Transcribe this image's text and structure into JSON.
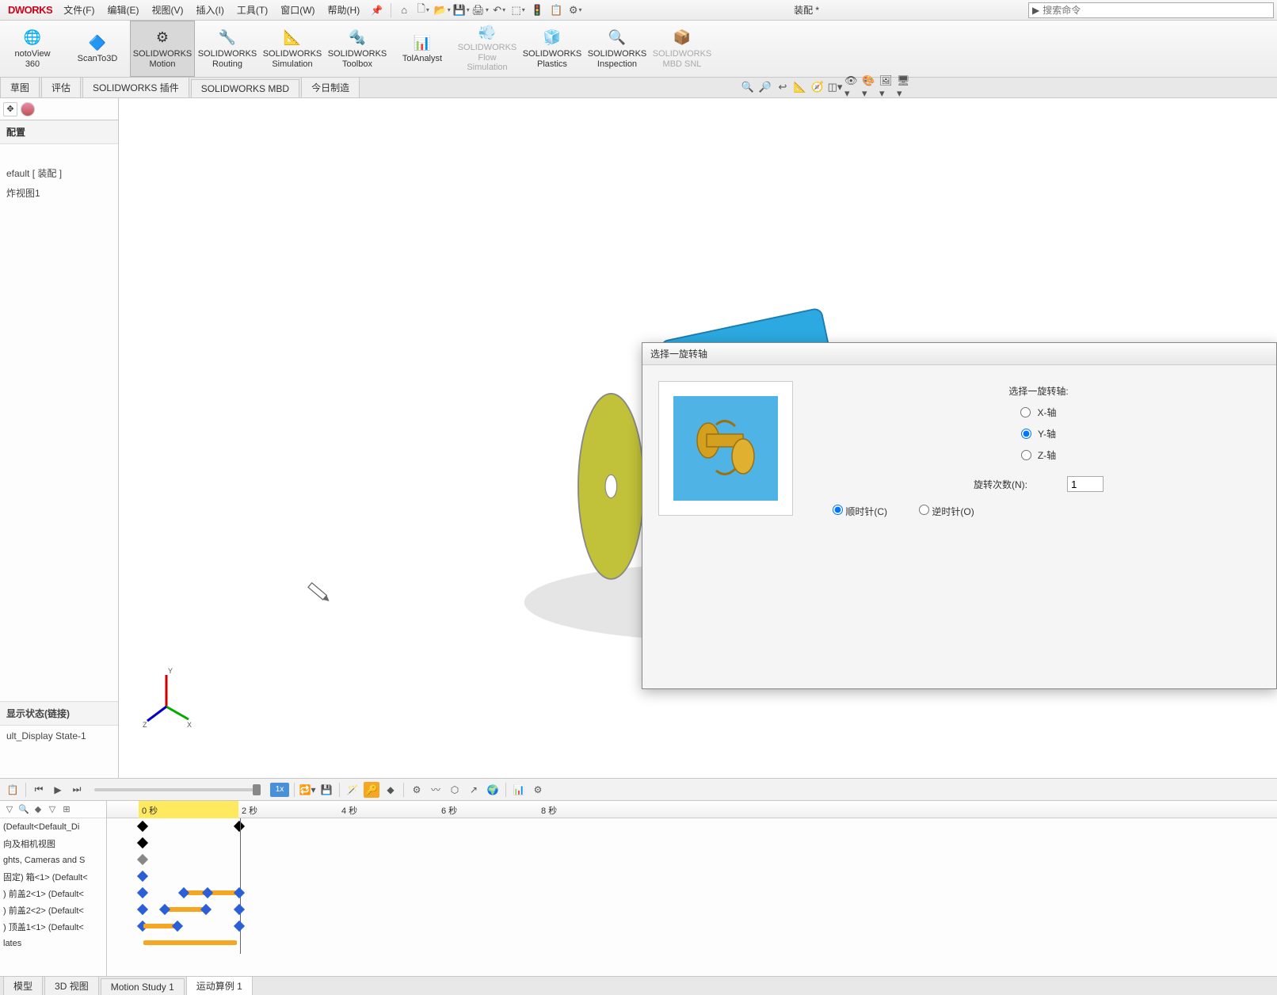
{
  "app": {
    "logo": "DWORKS"
  },
  "menu": {
    "file": "文件(F)",
    "edit": "编辑(E)",
    "view": "视图(V)",
    "insert": "插入(I)",
    "tools": "工具(T)",
    "window": "窗口(W)",
    "help": "帮助(H)"
  },
  "doc_title": "装配 *",
  "search": {
    "placeholder": "搜索命令"
  },
  "ribbon": {
    "photoview": {
      "l1": "notoView",
      "l2": "360"
    },
    "scanto3d": {
      "l1": "ScanTo3D"
    },
    "motion": {
      "l1": "SOLIDWORKS",
      "l2": "Motion"
    },
    "routing": {
      "l1": "SOLIDWORKS",
      "l2": "Routing"
    },
    "simulation": {
      "l1": "SOLIDWORKS",
      "l2": "Simulation"
    },
    "toolbox": {
      "l1": "SOLIDWORKS",
      "l2": "Toolbox"
    },
    "tolanalyst": {
      "l1": "TolAnalyst"
    },
    "flowsim": {
      "l1": "SOLIDWORKS",
      "l2": "Flow Simulation"
    },
    "plastics": {
      "l1": "SOLIDWORKS",
      "l2": "Plastics"
    },
    "inspection": {
      "l1": "SOLIDWORKS",
      "l2": "Inspection"
    },
    "mbdsnl": {
      "l1": "SOLIDWORKS",
      "l2": "MBD SNL"
    }
  },
  "subtabs": {
    "sketch": "草图",
    "evaluate": "评估",
    "plugins": "SOLIDWORKS 插件",
    "mbd": "SOLIDWORKS MBD",
    "today": "今日制造"
  },
  "left_panel": {
    "config_header": "配置",
    "item_default": "efault [ 装配 ]",
    "item_exploded": "炸视图1",
    "display_state_header": "显示状态(链接)",
    "display_state_item": "ult_Display State-1"
  },
  "dialog": {
    "title": "选择一旋转轴",
    "label": "选择一旋转轴:",
    "x_axis": "X-轴",
    "y_axis": "Y-轴",
    "z_axis": "Z-轴",
    "rotations_label": "旋转次数(N):",
    "rotations_value": "1",
    "cw": "顺时针(C)",
    "ccw": "逆时针(O)"
  },
  "timeline": {
    "speed": "1x",
    "ruler": {
      "t0": "0 秒",
      "t2": "2 秒",
      "t4": "4 秒",
      "t6": "6 秒",
      "t8": "8 秒"
    },
    "rows": {
      "r0": "(Default<Default_Di",
      "r1": "向及相机视图",
      "r2": "ghts, Cameras and S",
      "r3": "固定) 箱<1> (Default<",
      "r4": ") 前盖2<1> (Default<",
      "r5": ") 前盖2<2> (Default<",
      "r6": ") 顶盖1<1> (Default<",
      "r7": "lates"
    }
  },
  "bottom_tabs": {
    "model": "模型",
    "view3d": "3D 视图",
    "motion1": "Motion Study 1",
    "motion2": "运动算例 1"
  }
}
